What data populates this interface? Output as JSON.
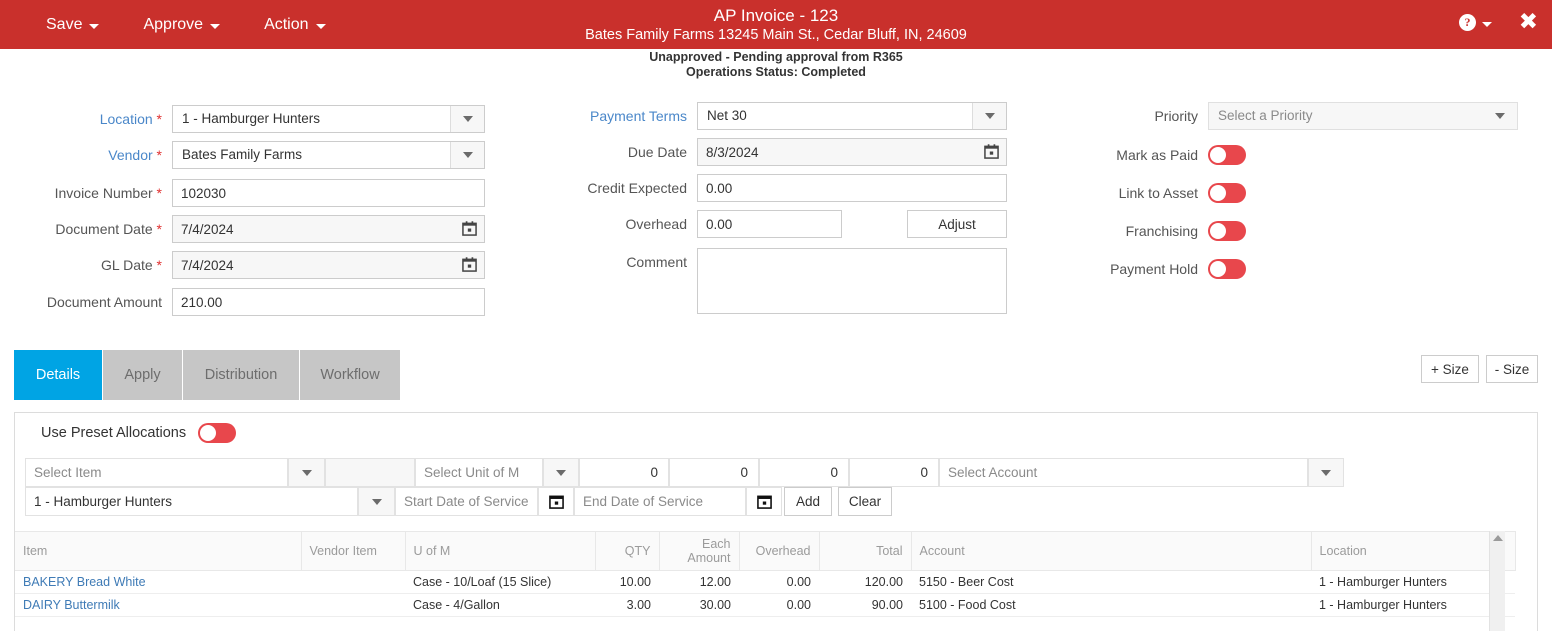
{
  "topbar": {
    "menus": [
      {
        "label": "Save"
      },
      {
        "label": "Approve"
      },
      {
        "label": "Action"
      }
    ],
    "title_main": "AP Invoice - 123",
    "title_sub": "Bates Family Farms 13245 Main St., Cedar Bluff, IN, 24609",
    "help_glyph": "?",
    "close_glyph": "✖",
    "bar_color": "#C9302C"
  },
  "status": {
    "approval": "Unapproved - Pending approval from R365",
    "operations": "Operations Status: Completed"
  },
  "form": {
    "left": [
      {
        "label": "Location",
        "required": true,
        "link": true,
        "type": "select",
        "value": "1 - Hamburger Hunters"
      },
      {
        "label": "Vendor",
        "required": true,
        "link": true,
        "type": "select",
        "value": "Bates Family Farms"
      },
      {
        "label": "Invoice Number",
        "required": true,
        "link": false,
        "type": "text",
        "value": "102030"
      },
      {
        "label": "Document Date",
        "required": true,
        "link": false,
        "type": "date",
        "value": "7/4/2024"
      },
      {
        "label": "GL Date",
        "required": true,
        "link": false,
        "type": "date",
        "value": "7/4/2024"
      },
      {
        "label": "Document Amount",
        "required": false,
        "link": false,
        "type": "text",
        "value": "210.00"
      }
    ],
    "middle": [
      {
        "label": "Payment Terms",
        "required": false,
        "link": true,
        "type": "select",
        "value": "Net 30"
      },
      {
        "label": "Due Date",
        "required": false,
        "link": false,
        "type": "date",
        "value": "8/3/2024"
      },
      {
        "label": "Credit Expected",
        "required": false,
        "link": false,
        "type": "text",
        "value": "0.00"
      },
      {
        "label": "Overhead",
        "required": false,
        "link": false,
        "type": "text-button",
        "value": "0.00",
        "button": "Adjust"
      },
      {
        "label": "Comment",
        "required": false,
        "link": false,
        "type": "textarea",
        "value": ""
      }
    ],
    "right": {
      "priority": {
        "label": "Priority",
        "value": "Select a Priority"
      },
      "toggles": [
        {
          "label": "Mark as Paid",
          "on": false
        },
        {
          "label": "Link to Asset",
          "on": false
        },
        {
          "label": "Franchising",
          "on": false
        },
        {
          "label": "Payment Hold",
          "on": false
        }
      ],
      "toggle_color": "#E8474C"
    }
  },
  "tabs": {
    "items": [
      {
        "label": "Details",
        "active": true
      },
      {
        "label": "Apply",
        "active": false
      },
      {
        "label": "Distribution",
        "active": false
      },
      {
        "label": "Workflow",
        "active": false
      }
    ],
    "active_color": "#00A4E4",
    "inactive_color": "#C6C6C6"
  },
  "size_buttons": {
    "plus": "+ Size",
    "minus": "- Size"
  },
  "grid_panel": {
    "preset_label": "Use Preset Allocations",
    "preset_on": false,
    "entry_row_1": {
      "item": "Select Item",
      "vendor_item": "",
      "uom": "Select Unit of M",
      "qty": "0",
      "each_amount": "0",
      "overhead": "0",
      "total": "0",
      "account": "Select Account"
    },
    "entry_row_2": {
      "location": "1 - Hamburger Hunters",
      "start_date": "Start Date of Service",
      "end_date": "End Date of Service",
      "add_button": "Add",
      "clear_button": "Clear"
    },
    "table": {
      "columns": [
        {
          "label": "Item",
          "align": "left"
        },
        {
          "label": "Vendor Item",
          "align": "left"
        },
        {
          "label": "U of M",
          "align": "left"
        },
        {
          "label": "QTY",
          "align": "right"
        },
        {
          "label": "Each Amount",
          "align": "right"
        },
        {
          "label": "Overhead",
          "align": "right"
        },
        {
          "label": "Total",
          "align": "right"
        },
        {
          "label": "Account",
          "align": "left"
        },
        {
          "label": "Location",
          "align": "left"
        }
      ],
      "rows": [
        {
          "item": "BAKERY Bread White",
          "vendor_item": "",
          "uom": "Case - 10/Loaf (15 Slice)",
          "qty": "10.00",
          "each_amount": "12.00",
          "overhead": "0.00",
          "total": "120.00",
          "account": "5150 - Beer Cost",
          "location": "1 - Hamburger Hunters"
        },
        {
          "item": "DAIRY Buttermilk",
          "vendor_item": "",
          "uom": "Case - 4/Gallon",
          "qty": "3.00",
          "each_amount": "30.00",
          "overhead": "0.00",
          "total": "90.00",
          "account": "5100 - Food Cost",
          "location": "1 - Hamburger Hunters"
        }
      ]
    }
  }
}
